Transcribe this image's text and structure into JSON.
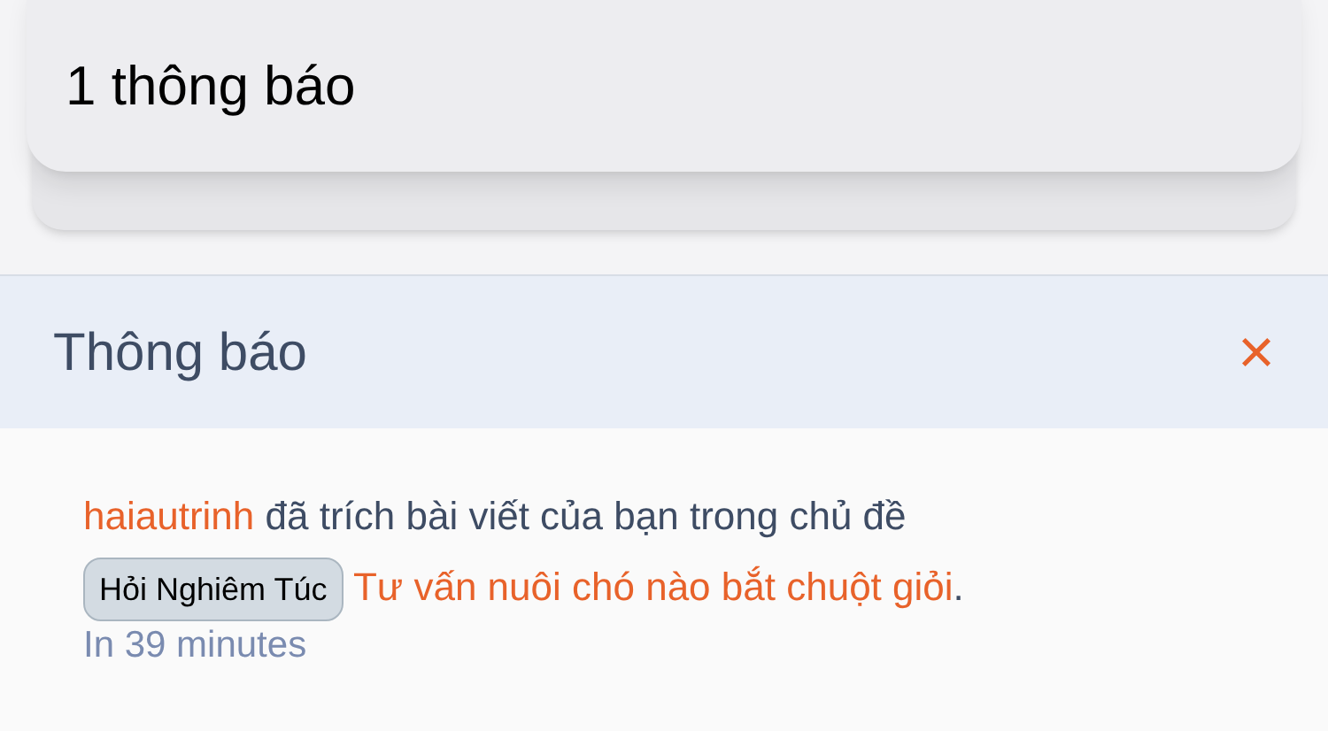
{
  "banner": {
    "text": "1 thông báo"
  },
  "panel": {
    "title": "Thông báo",
    "close": "×"
  },
  "notifications": [
    {
      "user": "haiautrinh",
      "action": "đã trích bài viết của bạn trong chủ đề",
      "tag": "Hỏi Nghiêm Túc",
      "thread": "Tư vấn nuôi chó nào bắt chuột giỏi",
      "end": ".",
      "time": "In 39 minutes"
    }
  ]
}
